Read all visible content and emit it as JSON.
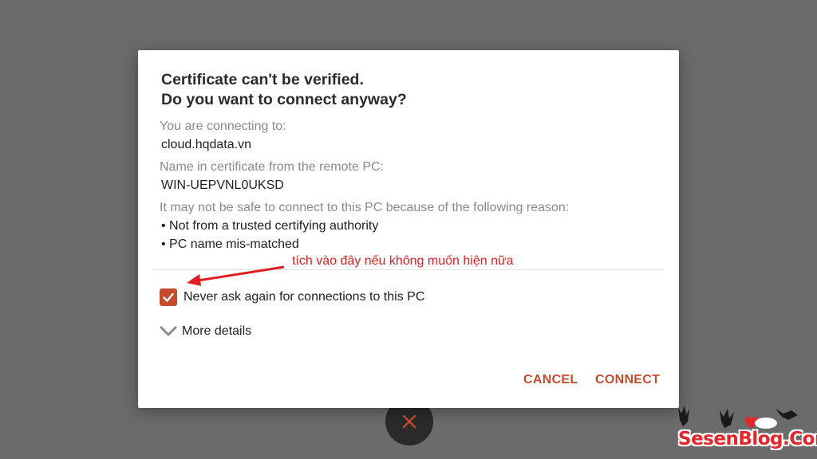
{
  "dialog": {
    "title_line1": "Certificate can't be verified.",
    "title_line2": "Do you want to connect anyway?",
    "connecting_to_label": "You are connecting to:",
    "connecting_to_value": "cloud.hqdata.vn",
    "cert_name_label": "Name in certificate from the remote PC:",
    "cert_name_value": "WIN-UEPVNL0UKSD",
    "reason_label": "It may not be safe to connect to this PC because of the following reason:",
    "reasons": [
      "• Not from a trusted certifying authority",
      "• PC name mis-matched"
    ],
    "checkbox_label": "Never ask again for connections to this PC",
    "checkbox_checked": true,
    "more_details_label": "More details",
    "cancel_label": "CANCEL",
    "connect_label": "CONNECT"
  },
  "annotation": {
    "text": "tích vào đây nếu không muốn hiện nữa",
    "color": "#e02020"
  },
  "watermark": {
    "text": "SesenBlog.Com"
  },
  "colors": {
    "accent": "#c64a2c",
    "backdrop": "#6b6b6b",
    "dialog_bg": "#ffffff"
  },
  "icons": {
    "checkbox": "checkmark-icon",
    "more_details": "chevron-down-icon",
    "background_fab": "close-icon"
  }
}
